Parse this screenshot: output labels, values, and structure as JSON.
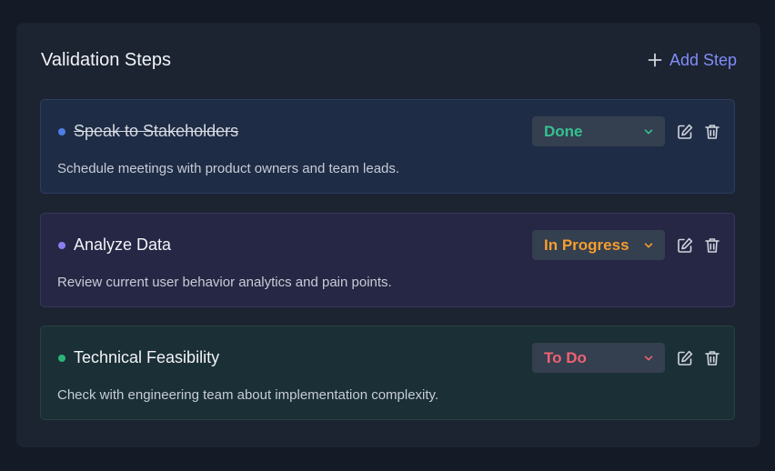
{
  "panel": {
    "title": "Validation Steps",
    "add_step_label": "Add Step"
  },
  "colors": {
    "accent": "#818cf8",
    "done": "#34c28f",
    "in_progress": "#f59e2e",
    "todo": "#f06272",
    "dot_blue": "#4d7ee8",
    "dot_purple": "#8b7cf0",
    "dot_green": "#2bb57a"
  },
  "steps": [
    {
      "title": "Speak to Stakeholders",
      "description": "Schedule meetings with product owners and team leads.",
      "status": "Done",
      "completed": true,
      "dot_color": "#4d7ee8",
      "status_color": "#34c28f"
    },
    {
      "title": "Analyze Data",
      "description": "Review current user behavior analytics and pain points.",
      "status": "In Progress",
      "completed": false,
      "dot_color": "#8b7cf0",
      "status_color": "#f59e2e"
    },
    {
      "title": "Technical Feasibility",
      "description": "Check with engineering team about implementation complexity.",
      "status": "To Do",
      "completed": false,
      "dot_color": "#2bb57a",
      "status_color": "#f06272"
    }
  ],
  "icons": {
    "add": "plus-icon",
    "dropdown": "chevron-down-icon",
    "edit": "edit-icon",
    "delete": "trash-icon"
  }
}
